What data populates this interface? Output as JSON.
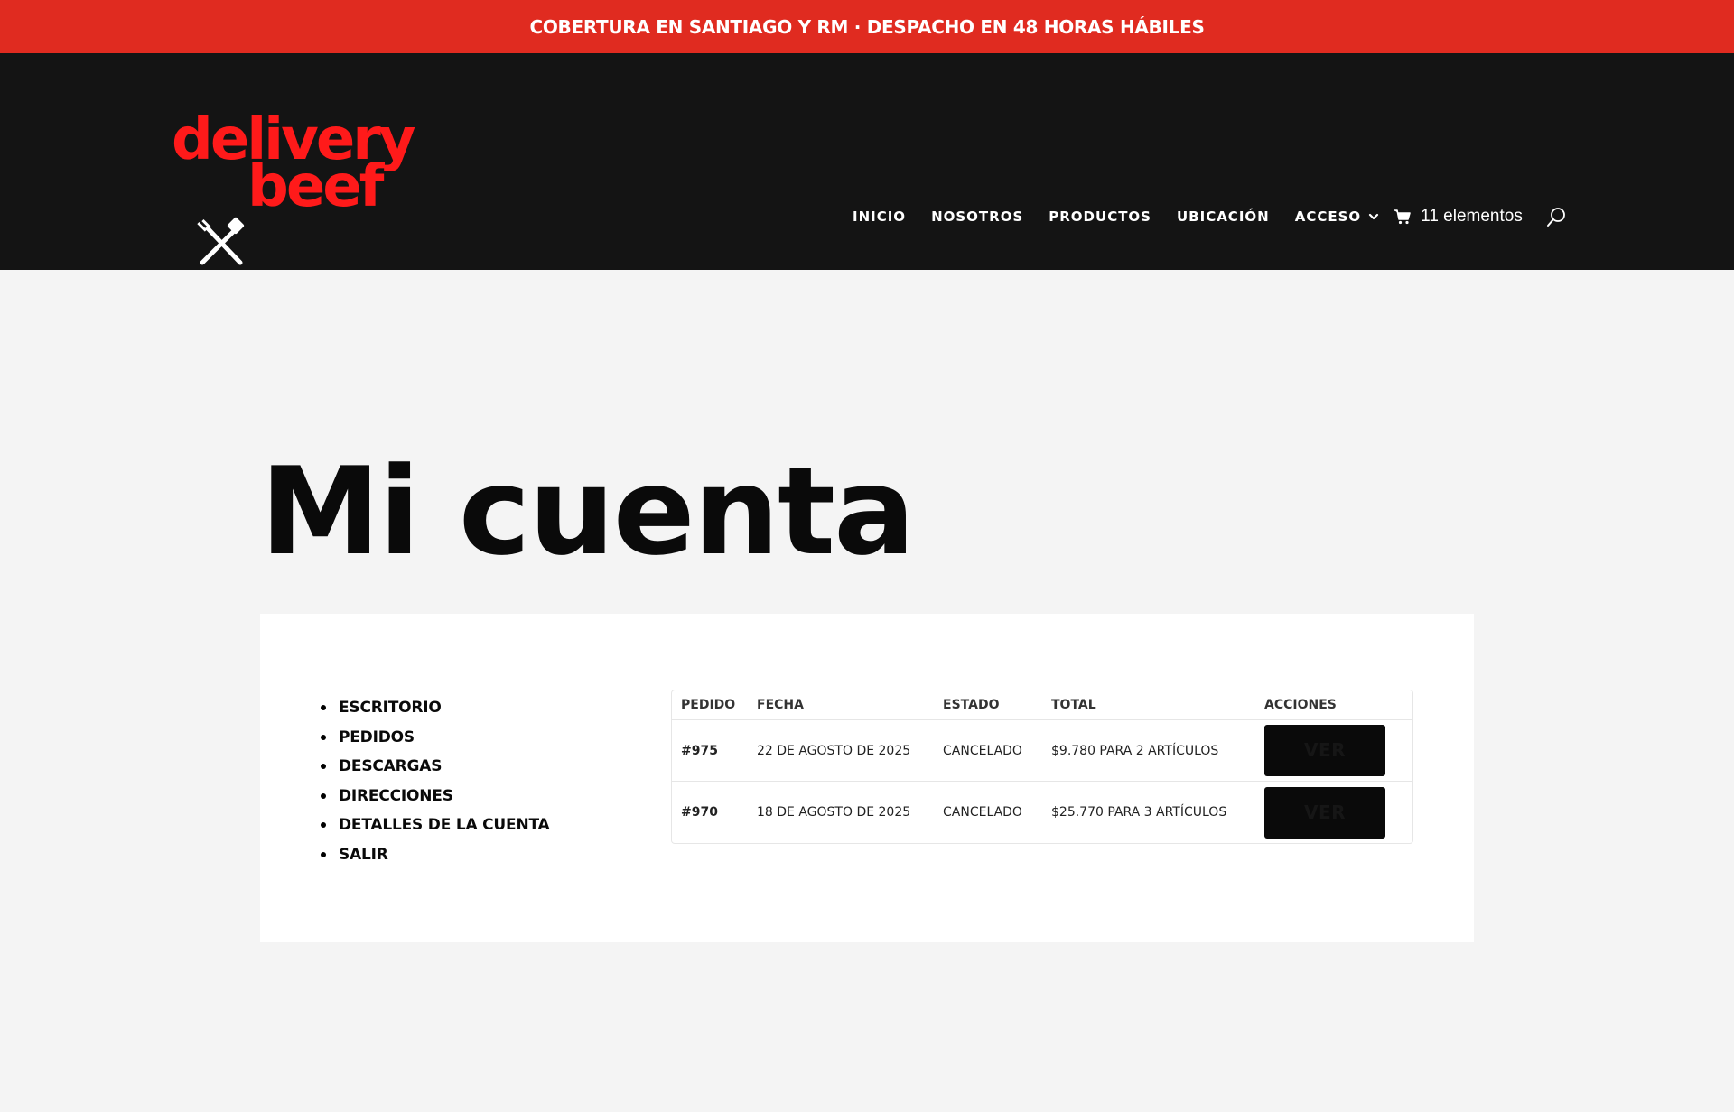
{
  "topbar": {
    "text": "COBERTURA EN SANTIAGO Y RM · DESPACHO EN 48 HORAS HÁBILES"
  },
  "header": {
    "logo": {
      "line1": "delivery",
      "line2": "beef"
    },
    "nav": [
      {
        "label": "INICIO"
      },
      {
        "label": "NOSOTROS"
      },
      {
        "label": "PRODUCTOS"
      },
      {
        "label": "UBICACIÓN"
      },
      {
        "label": "ACCESO",
        "has_dropdown": true
      }
    ],
    "cart": {
      "label": "11 elementos",
      "icon": "cart-icon"
    },
    "search": {
      "icon": "search-icon"
    }
  },
  "page": {
    "title": "Mi cuenta"
  },
  "account_nav": [
    {
      "label": "ESCRITORIO"
    },
    {
      "label": "PEDIDOS"
    },
    {
      "label": "DESCARGAS"
    },
    {
      "label": "DIRECCIONES"
    },
    {
      "label": "DETALLES DE LA CUENTA"
    },
    {
      "label": "SALIR"
    }
  ],
  "orders": {
    "headers": {
      "order": "PEDIDO",
      "date": "FECHA",
      "status": "ESTADO",
      "total": "TOTAL",
      "actions": "ACCIONES"
    },
    "rows": [
      {
        "order": "#975",
        "date": "22 DE AGOSTO DE 2025",
        "status": "CANCELADO",
        "total": "$9.780 PARA 2 ARTÍCULOS",
        "action": "VER"
      },
      {
        "order": "#970",
        "date": "18 DE AGOSTO DE 2025",
        "status": "CANCELADO",
        "total": "$25.770 PARA 3 ARTÍCULOS",
        "action": "VER"
      }
    ]
  },
  "colors": {
    "topbar_bg": "#e02b20",
    "header_bg": "#141414",
    "logo_red": "#ff1a1a",
    "page_bg": "#f4f4f4",
    "button_bg": "#0a0a0a"
  }
}
